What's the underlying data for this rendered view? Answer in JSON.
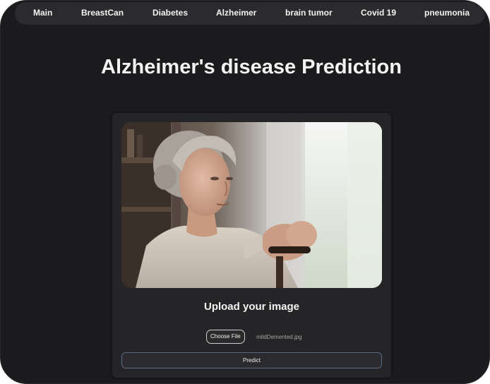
{
  "nav": {
    "items": [
      {
        "label": "Main"
      },
      {
        "label": "BreastCan"
      },
      {
        "label": "Diabetes"
      },
      {
        "label": "Alzheimer"
      },
      {
        "label": "brain tumor"
      },
      {
        "label": "Covid 19"
      },
      {
        "label": "pneumonia"
      }
    ]
  },
  "page": {
    "title": "Alzheimer's disease Prediction"
  },
  "card": {
    "image_subject": "elderly woman holding walking cane by window",
    "upload_heading": "Upload your image",
    "choose_file_label": "Choose File",
    "file_name": "mildDemented.jpg",
    "predict_label": "Predict"
  },
  "colors": {
    "background": "#1b1b1d",
    "nav_background": "#2b2b2e",
    "card_background": "#252527",
    "predict_border": "#5a6b86"
  }
}
